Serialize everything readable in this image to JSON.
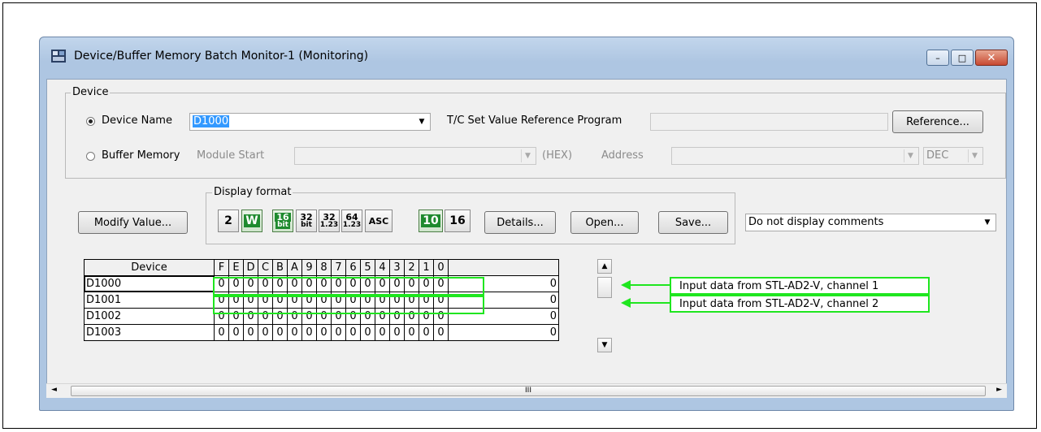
{
  "window": {
    "title": "Device/Buffer Memory Batch Monitor-1 (Monitoring)",
    "buttons": {
      "minimize": "–",
      "maximize": "□",
      "close": "✕"
    }
  },
  "device_group": {
    "legend": "Device",
    "device_name_label": "Device Name",
    "device_name_value": "D1000",
    "tc_label": "T/C Set Value Reference Program",
    "tc_value": "",
    "reference_button": "Reference...",
    "buffer_memory_label": "Buffer Memory",
    "module_start_label": "Module Start",
    "module_start_value": "",
    "hex_label": "(HEX)",
    "address_label": "Address",
    "address_value": "",
    "address_format": "DEC"
  },
  "toolbar": {
    "modify_value": "Modify Value...",
    "display_format_legend": "Display format",
    "fmt_2": "2",
    "fmt_w": "W",
    "fmt_16_top": "16",
    "fmt_16_sub": "bit",
    "fmt_32_top": "32",
    "fmt_32_sub": "bit",
    "fmt_32f_top": "32",
    "fmt_32f_sub": "1.23",
    "fmt_64_top": "64",
    "fmt_64_sub": "1.23",
    "fmt_asc": "ASC",
    "fmt_10": "10",
    "fmt_16": "16",
    "details": "Details...",
    "open": "Open...",
    "save": "Save...",
    "comment_option": "Do not display comments"
  },
  "table": {
    "header_device": "Device",
    "bit_headers": [
      "F",
      "E",
      "D",
      "C",
      "B",
      "A",
      "9",
      "8",
      "7",
      "6",
      "5",
      "4",
      "3",
      "2",
      "1",
      "0"
    ],
    "rows": [
      {
        "device": "D1000",
        "bits": [
          "0",
          "0",
          "0",
          "0",
          "0",
          "0",
          "0",
          "0",
          "0",
          "0",
          "0",
          "0",
          "0",
          "0",
          "0",
          "0"
        ],
        "value": "0"
      },
      {
        "device": "D1001",
        "bits": [
          "0",
          "0",
          "0",
          "0",
          "0",
          "0",
          "0",
          "0",
          "0",
          "0",
          "0",
          "0",
          "0",
          "0",
          "0",
          "0"
        ],
        "value": "0"
      },
      {
        "device": "D1002",
        "bits": [
          "0",
          "0",
          "0",
          "0",
          "0",
          "0",
          "0",
          "0",
          "0",
          "0",
          "0",
          "0",
          "0",
          "0",
          "0",
          "0"
        ],
        "value": "0"
      },
      {
        "device": "D1003",
        "bits": [
          "0",
          "0",
          "0",
          "0",
          "0",
          "0",
          "0",
          "0",
          "0",
          "0",
          "0",
          "0",
          "0",
          "0",
          "0",
          "0"
        ],
        "value": "0"
      }
    ]
  },
  "annotations": [
    "Input data from STL-AD2-V, channel 1",
    "Input data from STL-AD2-V, channel 2"
  ],
  "hscroll": {
    "thumb": "III"
  },
  "colors": {
    "highlight": "#1fe61f",
    "format_green": "#1e8a2e"
  }
}
